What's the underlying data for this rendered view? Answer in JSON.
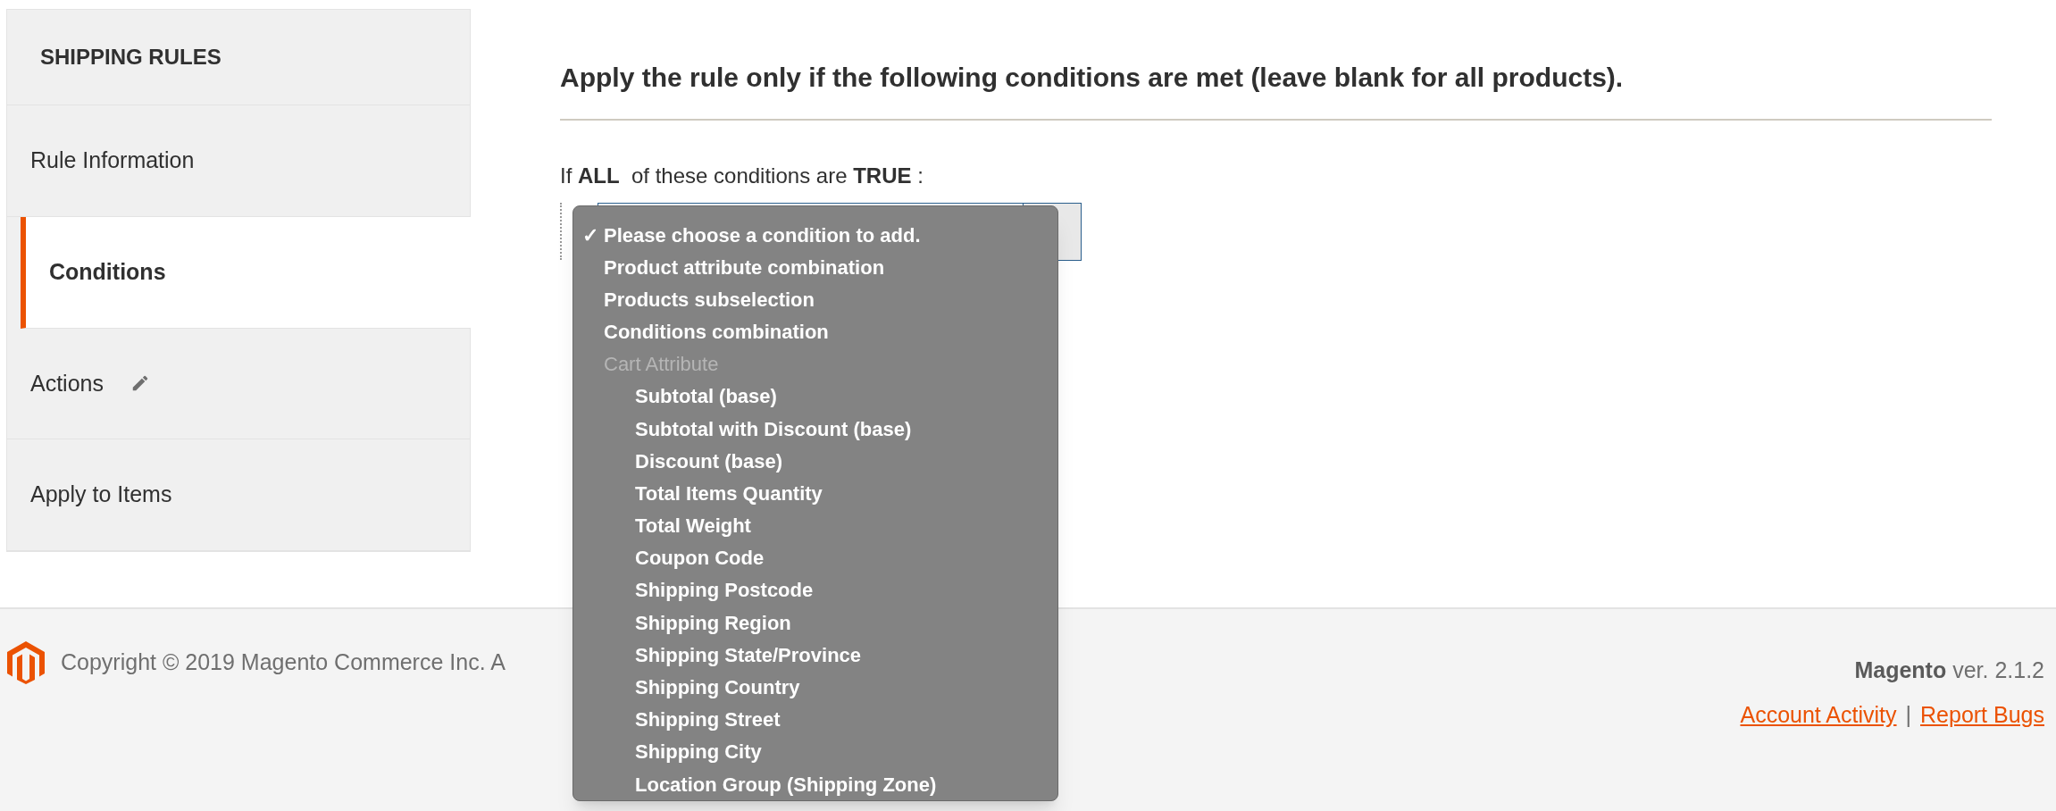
{
  "sidebar": {
    "title": "SHIPPING RULES",
    "items": [
      {
        "label": "Rule Information",
        "selected": false,
        "changed": false
      },
      {
        "label": "Conditions",
        "selected": true,
        "changed": false
      },
      {
        "label": "Actions",
        "selected": false,
        "changed": true
      },
      {
        "label": "Apply to Items",
        "selected": false,
        "changed": false
      }
    ]
  },
  "section": {
    "heading": "Apply the rule only if the following conditions are met (leave blank for all products).",
    "condition_sentence": "If **ALL**  of these conditions are **TRUE** :"
  },
  "dropdown": {
    "options": [
      {
        "kind": "option",
        "label": "Please choose a condition to add.",
        "selected": true
      },
      {
        "kind": "option",
        "label": "Product attribute combination",
        "selected": false
      },
      {
        "kind": "option",
        "label": "Products subselection",
        "selected": false
      },
      {
        "kind": "option",
        "label": "Conditions combination",
        "selected": false
      },
      {
        "kind": "group",
        "label": "Cart Attribute",
        "children": [
          {
            "label": "Subtotal (base)",
            "selected": false
          },
          {
            "label": "Subtotal with Discount (base)",
            "selected": false
          },
          {
            "label": "Discount (base)",
            "selected": false
          },
          {
            "label": "Total Items Quantity",
            "selected": false
          },
          {
            "label": "Total Weight",
            "selected": false
          },
          {
            "label": "Coupon Code",
            "selected": false
          },
          {
            "label": "Shipping Postcode",
            "selected": false
          },
          {
            "label": "Shipping Region",
            "selected": false
          },
          {
            "label": "Shipping State/Province",
            "selected": false
          },
          {
            "label": "Shipping Country",
            "selected": false
          },
          {
            "label": "Shipping Street",
            "selected": false
          },
          {
            "label": "Shipping City",
            "selected": false
          },
          {
            "label": "Location Group (Shipping Zone)",
            "selected": false
          }
        ]
      }
    ],
    "check_mark": "✓"
  },
  "footer": {
    "copyright": "Copyright © 2019 Magento Commerce Inc. A",
    "brand": "Magento",
    "version": " ver. 2.1.2",
    "links": [
      "Account Activity",
      "Report Bugs"
    ],
    "separator": "|"
  }
}
